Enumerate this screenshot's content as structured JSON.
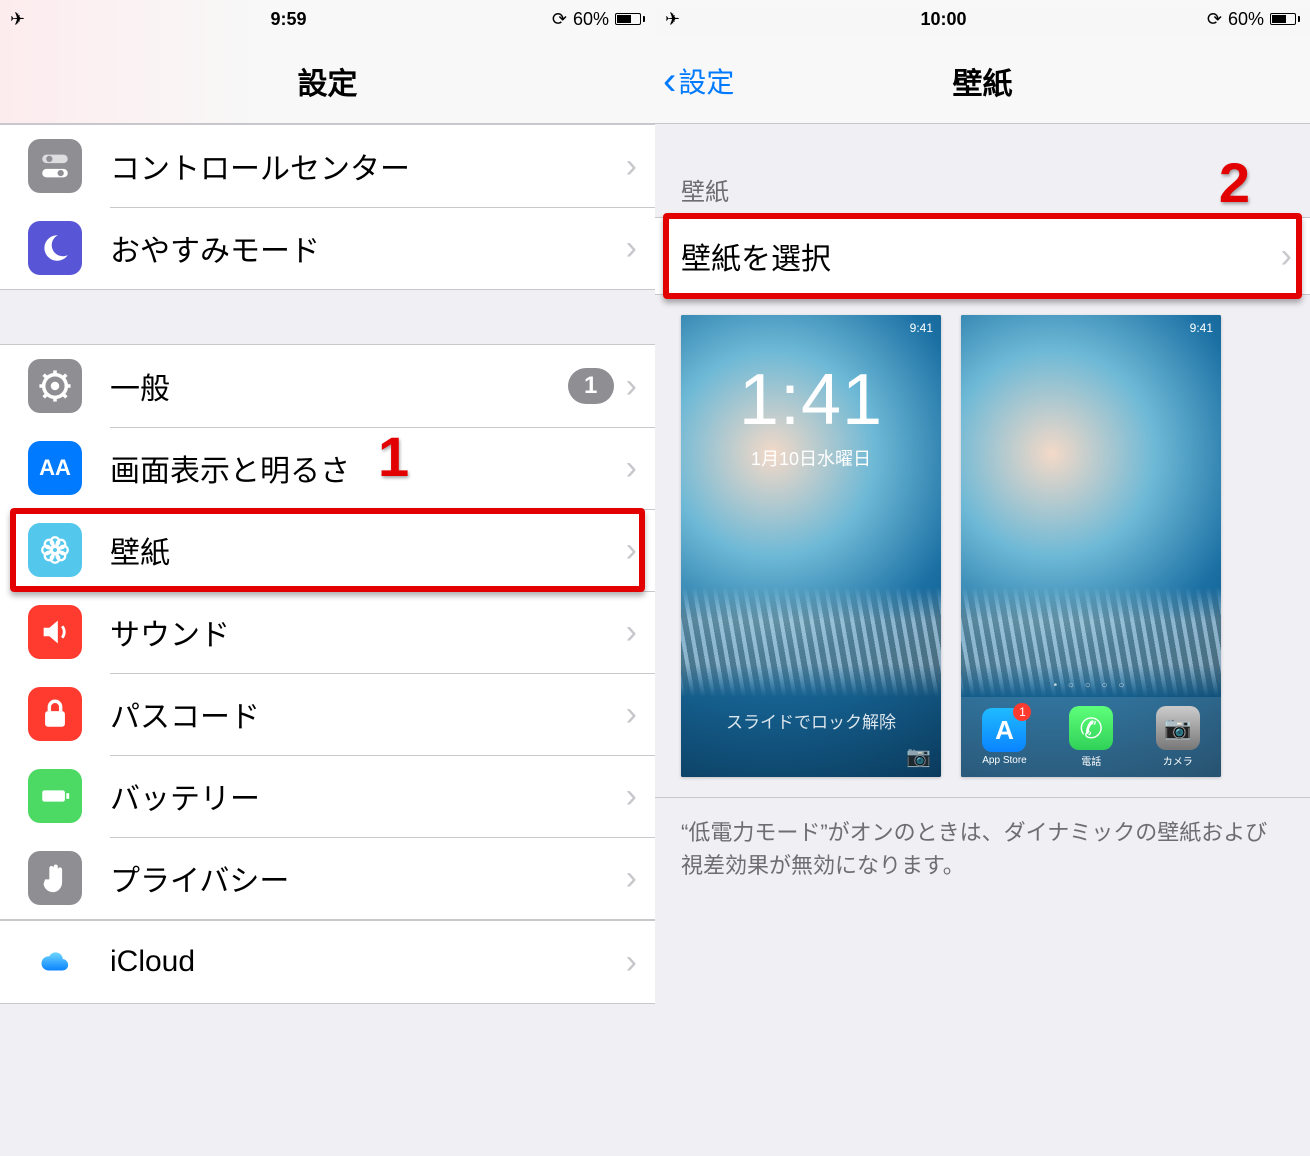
{
  "left": {
    "status": {
      "time": "9:59",
      "battery_pct": "60%"
    },
    "nav": {
      "title": "設定"
    },
    "group1": {
      "control_center": "コントロールセンター",
      "dnd": "おやすみモード"
    },
    "group2": {
      "general": "一般",
      "general_badge": "1",
      "display": "画面表示と明るさ",
      "wallpaper": "壁紙",
      "sounds": "サウンド",
      "passcode": "パスコード",
      "battery": "バッテリー",
      "privacy": "プライバシー"
    },
    "group3": {
      "icloud": "iCloud"
    },
    "callout": {
      "num": "1"
    }
  },
  "right": {
    "status": {
      "time": "10:00",
      "battery_pct": "60%"
    },
    "nav": {
      "back": "設定",
      "title": "壁紙"
    },
    "section_header": "壁紙",
    "choose_wallpaper": "壁紙を選択",
    "callout": {
      "num": "2"
    },
    "preview_lock": {
      "clock": "1:41",
      "date": "1月10日水曜日",
      "slide": "スライドでロック解除",
      "sb_time": "9:41"
    },
    "preview_home": {
      "sb_time": "9:41",
      "apps": {
        "appstore": {
          "label": "App Store",
          "badge": "1"
        },
        "phone": {
          "label": "電話"
        },
        "camera": {
          "label": "カメラ"
        }
      }
    },
    "footer_note": "“低電力モード”がオンのときは、ダイナミックの壁紙および視差効果が無効になります。"
  }
}
